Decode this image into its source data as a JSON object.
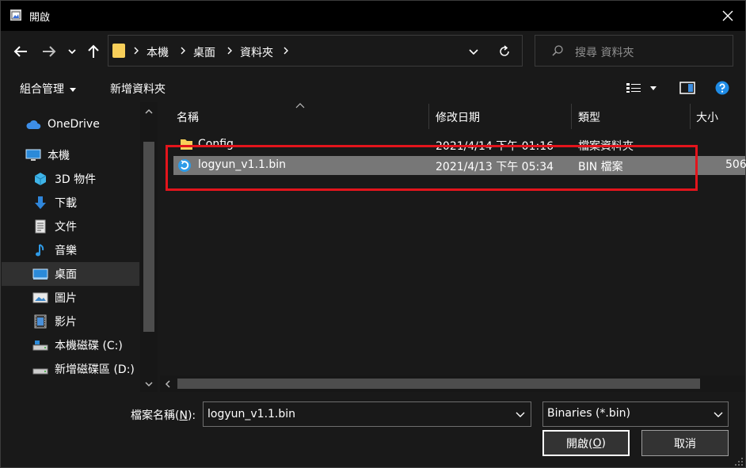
{
  "window": {
    "title": "開啟"
  },
  "nav": {
    "back_icon": "arrow-left-icon",
    "forward_icon": "arrow-right-icon",
    "recent_icon": "chevron-down-icon",
    "up_icon": "arrow-up-icon"
  },
  "address": {
    "crumbs": [
      "本機",
      "桌面",
      "資料夾"
    ]
  },
  "search": {
    "placeholder": "搜尋 資料夾"
  },
  "toolbar": {
    "organize_label": "組合管理",
    "new_folder_label": "新增資料夾"
  },
  "sidebar": {
    "items": [
      {
        "label": "OneDrive",
        "icon": "cloud-icon"
      },
      {
        "label": "本機",
        "icon": "computer-icon"
      },
      {
        "label": "3D 物件",
        "icon": "cube-icon"
      },
      {
        "label": "下載",
        "icon": "download-icon"
      },
      {
        "label": "文件",
        "icon": "document-icon"
      },
      {
        "label": "音樂",
        "icon": "music-icon"
      },
      {
        "label": "桌面",
        "icon": "desktop-icon",
        "selected": true
      },
      {
        "label": "圖片",
        "icon": "picture-icon"
      },
      {
        "label": "影片",
        "icon": "video-icon"
      },
      {
        "label": "本機磁碟 (C:)",
        "icon": "drive-icon"
      },
      {
        "label": "新增磁碟區 (D:)",
        "icon": "drive-icon"
      }
    ]
  },
  "filelist": {
    "columns": [
      "名稱",
      "修改日期",
      "類型",
      "大小"
    ],
    "rows": [
      {
        "name": "Config",
        "date": "2021/4/14 下午 01:16",
        "type": "檔案資料夾",
        "size": "",
        "icon": "folder-icon"
      },
      {
        "name": "logyun_v1.1.bin",
        "date": "2021/4/13 下午 05:34",
        "type": "BIN 檔案",
        "size": "506",
        "icon": "bin-file-icon",
        "selected": true
      }
    ]
  },
  "footer": {
    "filename_label": "檔案名稱(",
    "filename_label_key": "N",
    "filename_label_end": "):",
    "filename_value": "logyun_v1.1.bin",
    "filter_value": "Binaries (*.bin)",
    "open_label": "開啟(",
    "open_key": "O",
    "open_end": ")",
    "cancel_label": "取消"
  },
  "colors": {
    "highlight": "#e3141c",
    "folder": "#f8cf59",
    "accent": "#1f8ce6"
  }
}
